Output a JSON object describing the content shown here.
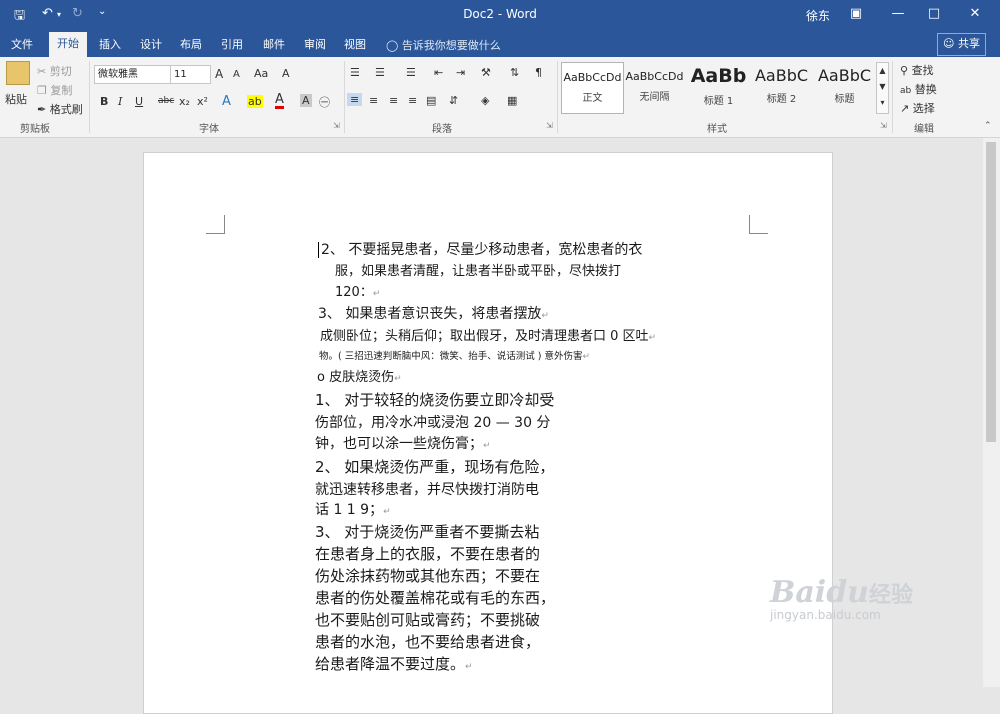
{
  "app": {
    "title": "Doc2 - Word",
    "user": "徐东"
  },
  "tabs": [
    "文件",
    "开始",
    "插入",
    "设计",
    "布局",
    "引用",
    "邮件",
    "审阅",
    "视图"
  ],
  "active_tab": "开始",
  "tell_me": "告诉我你想要做什么",
  "share": "共享",
  "clipboard": {
    "paste": "粘贴",
    "cut": "剪切",
    "copy": "复制",
    "painter": "格式刷",
    "group": "剪贴板"
  },
  "font": {
    "name": "微软雅黑",
    "size": "11",
    "grow": "A",
    "shrink": "A",
    "case": "Aa",
    "clear": "A",
    "bold": "B",
    "italic": "I",
    "underline": "U",
    "strike": "abc",
    "sub": "x₂",
    "sup": "x²",
    "effects": "A",
    "highlight": "ab",
    "color": "A",
    "shade": "A",
    "phon": "㊀",
    "group": "字体"
  },
  "paragraph": {
    "group": "段落"
  },
  "styles": {
    "group": "样式",
    "items": [
      {
        "sample": "AaBbCcDd",
        "name": "正文"
      },
      {
        "sample": "AaBbCcDd",
        "name": "无间隔"
      },
      {
        "sample": "AaBb",
        "name": "标题 1"
      },
      {
        "sample": "AaBbC",
        "name": "标题 2"
      },
      {
        "sample": "AaBbC",
        "name": "标题"
      }
    ]
  },
  "editing": {
    "find": "查找",
    "replace": "替换",
    "select": "选择",
    "group": "编辑"
  },
  "doc": {
    "lines": [
      "2、 不要摇晃患者，尽量少移动患者，宽松患者的衣",
      "服，如果患者清醒，让患者半卧或平卧，尽快拨打",
      "120：",
      "3、 如果患者意识丧失，将患者摆放",
      "成侧卧位；头稍后仰；取出假牙，及时清理患者口 0 区吐",
      "物。( 三招迅速判断脑中风：微笑、抬手、说话测试 ) 意外伤害",
      "o 皮肤烧烫伤",
      "1、 对于较轻的烧烫伤要立即冷却受",
      "伤部位，用冷水冲或浸泡 20 — 30 分",
      "钟，也可以涂一些烧伤膏；",
      "2、 如果烧烫伤严重，现场有危险，",
      "就迅速转移患者，并尽快拨打消防电",
      "话 1 1 9；",
      "3、 对于烧烫伤严重者不要撕去粘",
      "在患者身上的衣服，不要在患者的",
      "伤处涂抹药物或其他东西；不要在",
      "患者的伤处覆盖棉花或有毛的东西，",
      "也不要贴创可贴或膏药；不要挑破",
      "患者的水泡，也不要给患者进食，",
      "给患者降温不要过度。"
    ]
  },
  "watermark": {
    "brand": "Baidu",
    "cn": "经验",
    "url": "jingyan.baidu.com"
  }
}
